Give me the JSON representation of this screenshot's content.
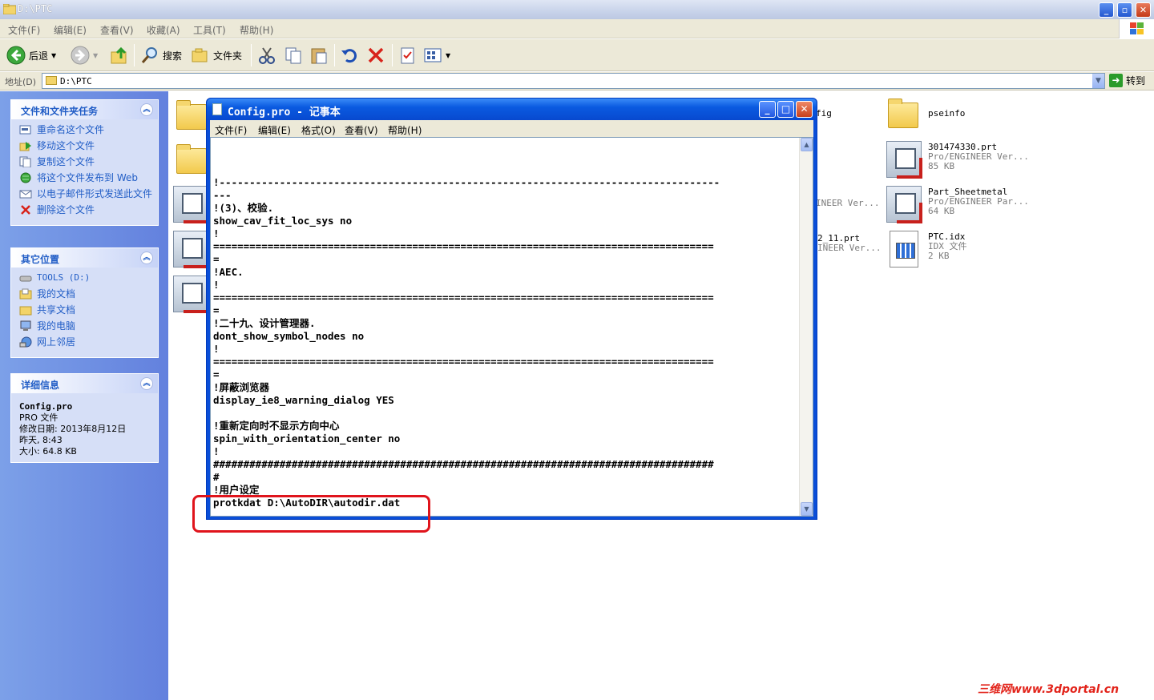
{
  "explorer": {
    "title": "D:\\PTC",
    "menu": [
      "文件(F)",
      "编辑(E)",
      "查看(V)",
      "收藏(A)",
      "工具(T)",
      "帮助(H)"
    ],
    "toolbar": {
      "back_label": "后退",
      "search_label": "搜索",
      "folders_label": "文件夹"
    },
    "address": {
      "label": "地址(D)",
      "value": "D:\\PTC",
      "go_label": "转到"
    }
  },
  "taskpane": {
    "file_tasks": {
      "header": "文件和文件夹任务",
      "items": [
        {
          "label": "重命名这个文件",
          "icon": "rename-icon"
        },
        {
          "label": "移动这个文件",
          "icon": "move-icon"
        },
        {
          "label": "复制这个文件",
          "icon": "copy-icon"
        },
        {
          "label": "将这个文件发布到 Web",
          "icon": "web-publish-icon"
        },
        {
          "label": "以电子邮件形式发送此文件",
          "icon": "email-icon"
        },
        {
          "label": "删除这个文件",
          "icon": "delete-icon"
        }
      ]
    },
    "other_places": {
      "header": "其它位置",
      "items": [
        {
          "label": "TOOLS (D:)",
          "icon": "drive-icon"
        },
        {
          "label": "我的文档",
          "icon": "my-documents-icon"
        },
        {
          "label": "共享文档",
          "icon": "shared-folder-icon"
        },
        {
          "label": "我的电脑",
          "icon": "my-computer-icon"
        },
        {
          "label": "网上邻居",
          "icon": "network-icon"
        }
      ]
    },
    "details": {
      "header": "详细信息",
      "name": "Config.pro",
      "type": "PRO 文件",
      "modified_label": "修改日期: 2013年8月12日",
      "modified_time": "昨天, 8:43",
      "size": "大小: 64.8 KB"
    }
  },
  "files": {
    "partial_left": [
      "",
      ""
    ],
    "partial_mid": [
      {
        "name": "fig",
        "sub": ""
      },
      {
        "name": "",
        "sub": "INEER Ver..."
      },
      {
        "name": "2_11.prt",
        "sub": "INEER Ver..."
      }
    ],
    "right": [
      {
        "name": "pseinfo",
        "sub1": "",
        "sub2": "",
        "icon": "folder-icon"
      },
      {
        "name": "301474330.prt",
        "sub1": "Pro/ENGINEER Ver...",
        "sub2": "85 KB",
        "icon": "proe-part-icon"
      },
      {
        "name": "Part_Sheetmetal",
        "sub1": "Pro/ENGINEER Par...",
        "sub2": "64 KB",
        "icon": "proe-part-icon"
      },
      {
        "name": "PTC.idx",
        "sub1": "IDX 文件",
        "sub2": "2 KB",
        "icon": "idx-file-icon"
      }
    ]
  },
  "notepad": {
    "title": "Config.pro - 记事本",
    "menu": [
      "文件(F)",
      "编辑(E)",
      "格式(O)",
      "查看(V)",
      "帮助(H)"
    ],
    "lines": [
      "",
      "",
      "",
      "!-----------------------------------------------------------------------------------",
      "---",
      "!(3)、校验.",
      "show_cav_fit_loc_sys no",
      "!",
      "===================================================================================",
      "=",
      "!AEC.",
      "!",
      "===================================================================================",
      "=",
      "!二十九、设计管理器.",
      "dont_show_symbol_nodes no",
      "!",
      "===================================================================================",
      "=",
      "!屏蔽浏览器",
      "display_ie8_warning_dialog YES",
      "",
      "!重新定向时不显示方向中心",
      "spin_with_orientation_center no",
      "!",
      "###################################################################################",
      "#",
      "!用户设定",
      "protkdat D:\\AutoDIR\\autodir.dat"
    ]
  },
  "watermark": "三维网www.3dportal.cn"
}
